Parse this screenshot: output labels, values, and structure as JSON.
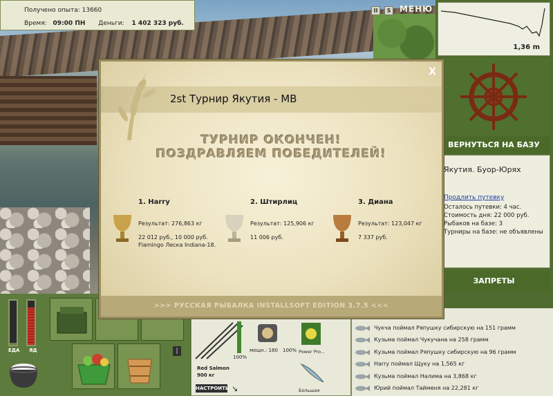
{
  "info": {
    "exp_label": "Получено опыта:",
    "exp_value": "13660",
    "time_label": "Время:",
    "time_value": "09:00 ПН",
    "money_label": "Деньги:",
    "money_value": "1 402 323 руб."
  },
  "scene": {
    "pause_label": "II",
    "sound_label": "S",
    "menu_label": "МЕНЮ"
  },
  "depth": {
    "value": "1,36 m"
  },
  "right": {
    "back_label": "ВЕРНУТЬСЯ НА БАЗУ",
    "location": "Якутия. Буор-Юрях",
    "extend_link": "Продлить путевку",
    "lines": [
      "Осталось путевки: 4 час.",
      "Стоимость дня: 22 000 руб.",
      "Рыбаков на базе: 3",
      "Турниры на базе: не объявлены"
    ],
    "bans_label": "ЗАПРЕТЫ"
  },
  "gauges": {
    "food_label": "ЕДА",
    "poison_label": "ЯД",
    "food_level": 0.05,
    "poison_level": 0.85
  },
  "tackle": {
    "rod_name": "Red Salmon",
    "rod_weight": "900 кг",
    "percent1": "100%",
    "reel_label": "мощн.: 180",
    "percent2": "100%",
    "line_label": "Power Pro...",
    "bait_label": "Большая",
    "tune_label": "НАСТРОИТЬ"
  },
  "catch_log": [
    "...2 грамм",
    "Чукча поймал Ряпушку сибирскую на 151 грамм",
    "Кузьма поймал Чукучана на 258 грамм",
    "Кузьма поймал Ряпушку сибирскую на 96 грамм",
    "Harry поймал Щуку на 1,565 кг",
    "Кузьма поймал Налима на 3,868 кг",
    "Юрий поймал Тайменя на 22,281 кг"
  ],
  "modal": {
    "close_label": "X",
    "title": "2st Турнир Якутия - MB",
    "headline1": "ТУРНИР ОКОНЧЕН!",
    "headline2": "ПОЗДРАВЛЯЕМ ПОБЕДИТЕЛЕЙ!",
    "winners": [
      {
        "place": "1. Harry",
        "result": "Результат: 276,863 кг",
        "prize1": "22 012 руб., 10 000 руб.",
        "prize2": "Flamingo Леска Indiana-18."
      },
      {
        "place": "2. Штирлиц",
        "result": "Результат: 125,906 кг",
        "prize1": "11 006 руб.",
        "prize2": ""
      },
      {
        "place": "3. Диана",
        "result": "Результат: 123,047 кг",
        "prize1": "7 337 руб.",
        "prize2": ""
      }
    ],
    "footer": ">>> РУССКАЯ РЫБАЛКА INSTALLSOFT EDITION 3.7.5 <<<"
  },
  "colors": {
    "gold": "#c9a34a",
    "silver": "#c8c3b4",
    "bronze": "#b77c3e",
    "panel_green": "#4b6a2a"
  }
}
